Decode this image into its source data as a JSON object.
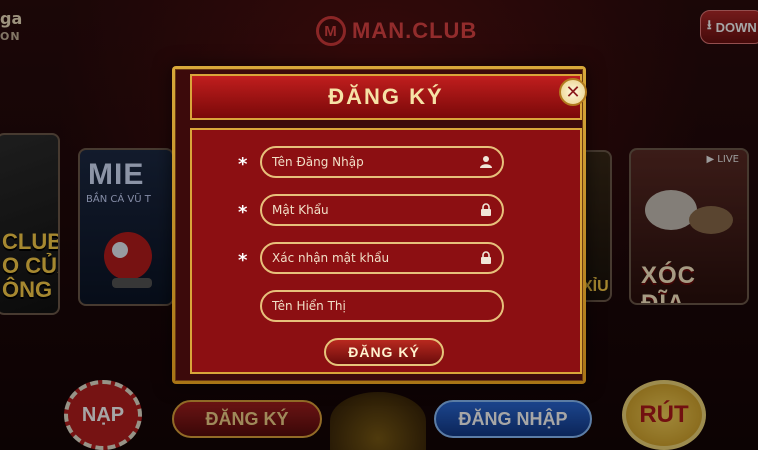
{
  "topbar": {
    "brand_left": "ga",
    "brand_left_sub": "ON",
    "center_logo_prefix": "M",
    "center_logo_text": "MAN.CLUB",
    "download_label": "DOWN"
  },
  "cards": {
    "left_title": "CLUB\nO CỦA\nÔNG",
    "middle_title": "MIE",
    "middle_sub": "BẮN CÁ VŨ T",
    "slot_title": "XỈU",
    "right_live": "▶ LIVE",
    "right_title": "XÓC ĐĨA"
  },
  "bottom": {
    "deposit": "NẠP",
    "register": "ĐĂNG KÝ",
    "login": "ĐĂNG NHẬP",
    "withdraw": "RÚT"
  },
  "modal": {
    "title": "ĐĂNG KÝ",
    "fields": [
      {
        "placeholder": "Tên Đăng Nhập",
        "required": "*",
        "icon": "user-icon"
      },
      {
        "placeholder": "Mật Khẩu",
        "required": "*",
        "icon": "lock-icon"
      },
      {
        "placeholder": "Xác nhận mật khẩu",
        "required": "*",
        "icon": "lock-icon"
      },
      {
        "placeholder": "Tên Hiển Thị",
        "required": "",
        "icon": ""
      }
    ],
    "submit_label": "ĐĂNG KÝ"
  },
  "colors": {
    "modal_panel": "#8c0f12",
    "gold_border": "#d9a53a",
    "title_text": "#f6e2a6"
  }
}
